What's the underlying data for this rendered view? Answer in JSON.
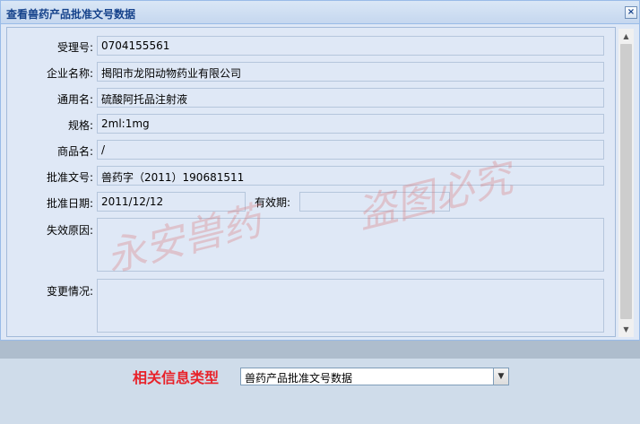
{
  "dialog": {
    "title": "查看兽药产品批准文号数据",
    "close_icon": "×"
  },
  "form": {
    "accept_no_label": "受理号:",
    "accept_no_value": "0704155561",
    "company_label": "企业名称:",
    "company_value": "揭阳市龙阳动物药业有限公司",
    "common_name_label": "通用名:",
    "common_name_value": "硫酸阿托品注射液",
    "spec_label": "规格:",
    "spec_value": "2ml:1mg",
    "trade_name_label": "商品名:",
    "trade_name_value": "/",
    "approval_no_label": "批准文号:",
    "approval_no_value": "兽药字（2011）190681511",
    "approval_date_label": "批准日期:",
    "approval_date_value": "2011/12/12",
    "validity_label": "有效期:",
    "validity_value": "",
    "invalid_reason_label": "失效原因:",
    "invalid_reason_value": "",
    "change_label": "变更情况:",
    "change_value": ""
  },
  "watermark": {
    "left": "永安兽药",
    "right": "盗图必究"
  },
  "bottom": {
    "related_label": "相关信息类型",
    "select_value": "兽药产品批准文号数据"
  },
  "icons": {
    "close": "close-icon",
    "scroll_up": "chevron-up-icon",
    "scroll_down": "chevron-down-icon",
    "dropdown": "chevron-down-icon"
  }
}
